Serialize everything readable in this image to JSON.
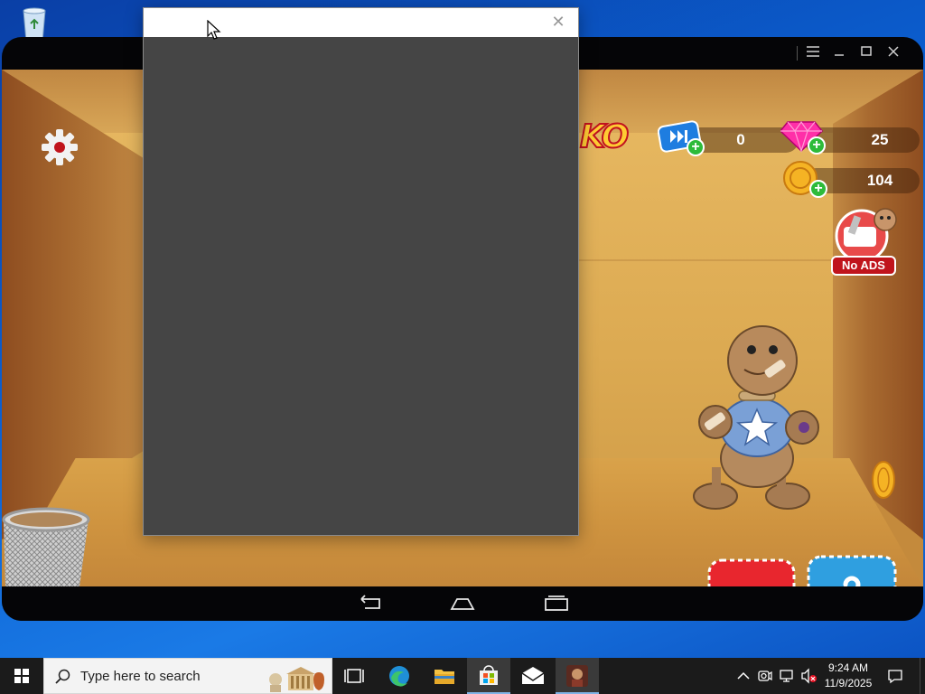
{
  "desktop": {
    "recycle_bin_icon": "recycle-bin-icon"
  },
  "emulator": {
    "controls": {
      "menu_icon": "menu-icon",
      "minimize_icon": "minimize-icon",
      "maximize_icon": "maximize-icon",
      "close_icon": "close-icon"
    }
  },
  "game": {
    "logo_text": "KO",
    "hud": {
      "tickets": "0",
      "gems": "25",
      "coins": "104",
      "no_ads_label": "No ADS"
    },
    "buttons": {
      "settings_icon": "gear-icon",
      "weapon_icon": "pistol-icon",
      "outfit_icon": "hanger-icon"
    }
  },
  "android_nav": {
    "back_icon": "back-icon",
    "home_icon": "home-icon",
    "recents_icon": "recents-icon"
  },
  "dialog": {
    "close_glyph": "✕"
  },
  "taskbar": {
    "search_placeholder": "Type here to search",
    "clock_time": "9:24 AM",
    "clock_date": "11/9/2025",
    "apps": [
      "start",
      "task-view",
      "edge",
      "file-explorer",
      "store",
      "mail",
      "game"
    ]
  },
  "colors": {
    "taskbar_bg": "#1b1b1b",
    "dialog_bg": "#454545",
    "accent_blue": "#0b5fd0",
    "plus_green": "#2dbb3a",
    "noads_red": "#c0141c"
  }
}
